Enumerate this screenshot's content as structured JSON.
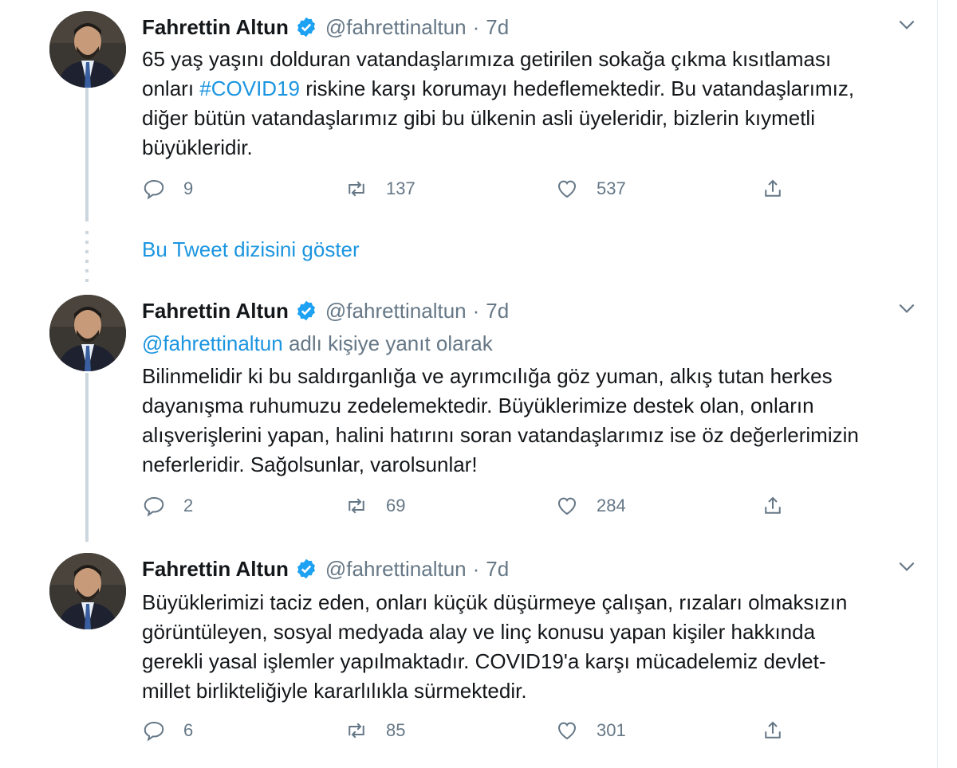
{
  "colors": {
    "link": "#1b95e0",
    "secondary_text": "#657786",
    "verified": "#1da1f2",
    "thread_line": "#ccd6dd"
  },
  "show_thread_label": "Bu Tweet dizisini göster",
  "tweets": [
    {
      "author_name": "Fahrettin Altun",
      "handle": "@fahrettinaltun",
      "separator": "·",
      "time": "7d",
      "verified_icon": "verified-badge-icon",
      "body_lines": [
        "65 yaş yaşını dolduran vatandaşlarımıza getirilen sokağa çıkma kısıtlaması",
        {
          "pre": "onları ",
          "link": "#COVID19",
          "post": " riskine karşı korumayı hedeflemektedir. Bu vatandaşlarımız,"
        },
        "diğer bütün vatandaşlarımız gibi bu ülkenin asli üyeleridir, bizlerin kıymetli",
        "büyükleridir."
      ],
      "replies": "9",
      "retweets": "137",
      "likes": "537"
    },
    {
      "author_name": "Fahrettin Altun",
      "handle": "@fahrettinaltun",
      "separator": "·",
      "time": "7d",
      "reply_to_handle": "@fahrettinaltun",
      "reply_to_suffix": " adlı kişiye yanıt olarak",
      "body_lines": [
        "Bilinmelidir ki bu saldırganlığa ve ayrımcılığa göz yuman, alkış tutan herkes",
        "dayanışma ruhumuzu zedelemektedir. Büyüklerimize destek olan, onların",
        "alışverişlerini yapan, halini hatırını soran vatandaşlarımız ise öz değerlerimizin",
        "neferleridir. Sağolsunlar, varolsunlar!"
      ],
      "replies": "2",
      "retweets": "69",
      "likes": "284"
    },
    {
      "author_name": "Fahrettin Altun",
      "handle": "@fahrettinaltun",
      "separator": "·",
      "time": "7d",
      "body_lines": [
        "Büyüklerimizi taciz eden, onları küçük düşürmeye çalışan, rızaları olmaksızın",
        "görüntüleyen, sosyal medyada alay ve linç konusu yapan kişiler hakkında",
        "gerekli yasal işlemler yapılmaktadır. COVID19'a karşı mücadelemiz devlet-",
        "millet birlikteliğiyle kararlılıkla sürmektedir."
      ],
      "replies": "6",
      "retweets": "85",
      "likes": "301"
    }
  ]
}
